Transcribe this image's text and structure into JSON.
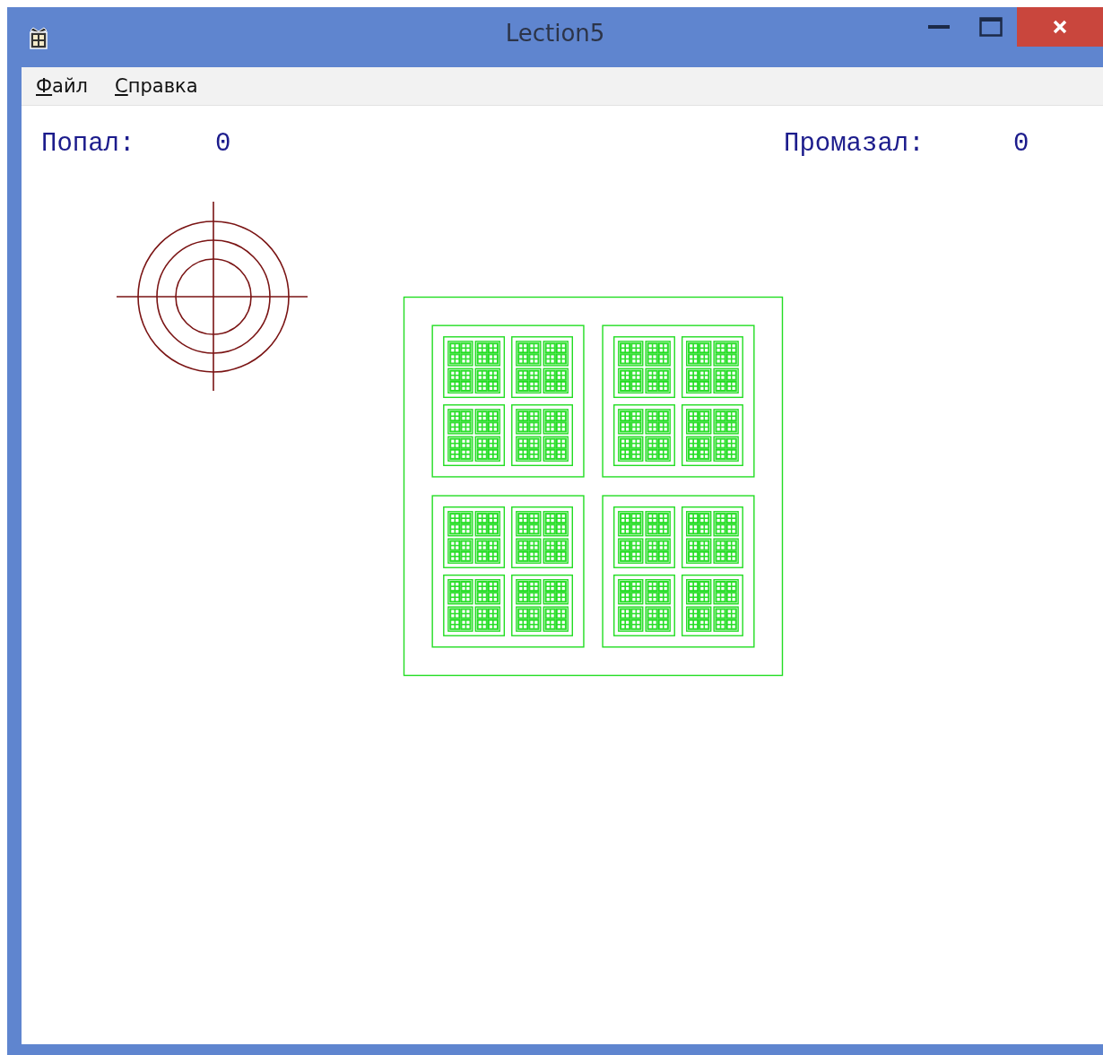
{
  "window": {
    "title": "Lection5"
  },
  "menu": [
    {
      "label": "Файл"
    },
    {
      "label": "Справка"
    }
  ],
  "score": {
    "hit_label": "Попал:",
    "hit_value": "0",
    "miss_label": "Промазал:",
    "miss_value": "0"
  }
}
